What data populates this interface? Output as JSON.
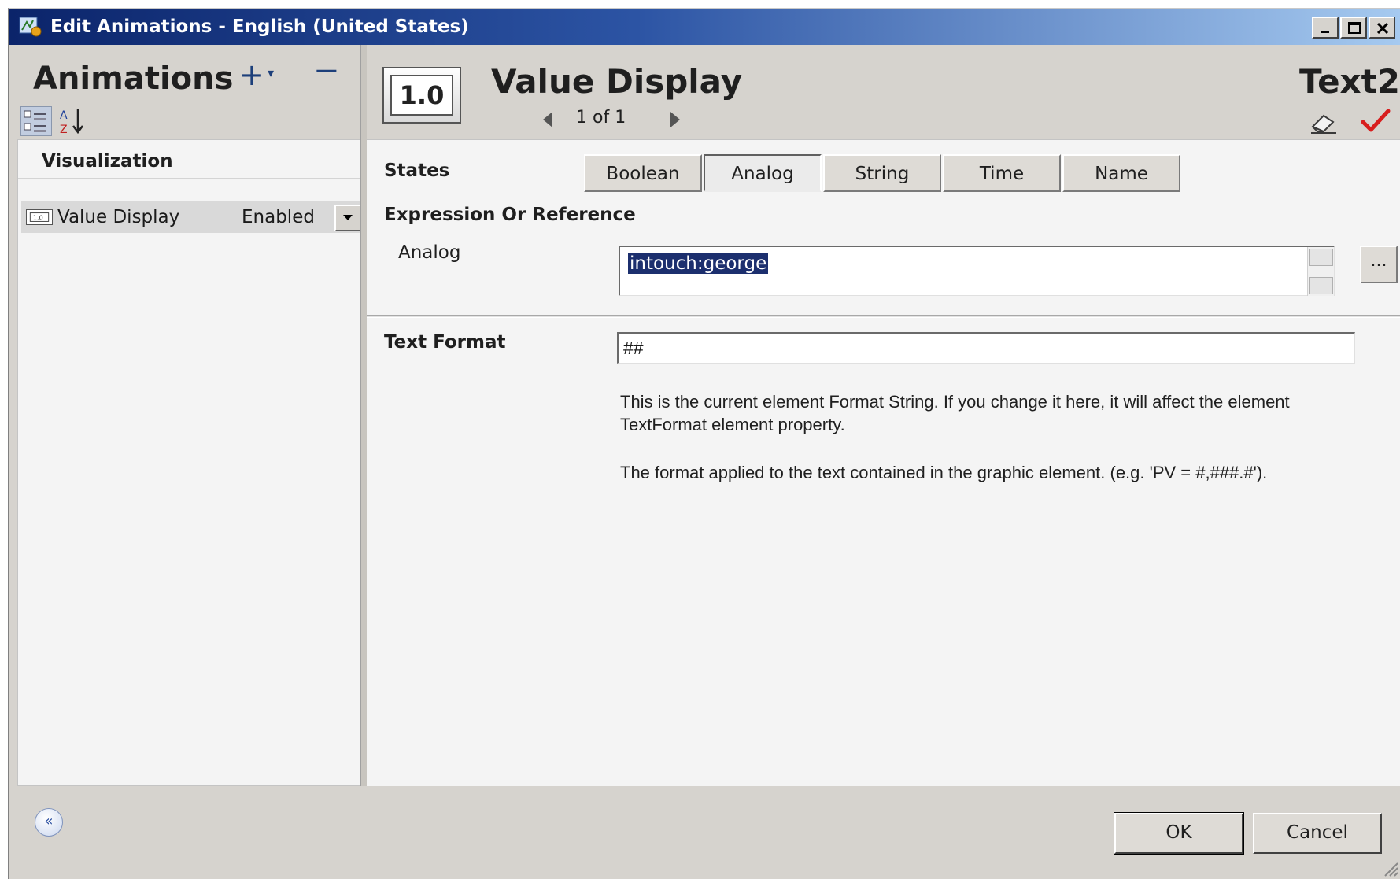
{
  "window": {
    "title": "Edit Animations - English (United States)"
  },
  "left_panel": {
    "title": "Animations",
    "add_label": "+",
    "remove_label": "−",
    "section": "Visualization",
    "animations": [
      {
        "name": "Value Display",
        "status": "Enabled"
      }
    ]
  },
  "header": {
    "badge": "1.0",
    "animation_name": "Value Display",
    "pager": "1 of 1",
    "element_name": "Text2"
  },
  "states": {
    "label": "States",
    "tabs": [
      "Boolean",
      "Analog",
      "String",
      "Time",
      "Name"
    ],
    "active": "Analog"
  },
  "expression": {
    "label": "Expression Or Reference",
    "field_label": "Analog",
    "value": "intouch:george",
    "browse_label": "..."
  },
  "text_format": {
    "label": "Text Format",
    "value": "##",
    "help_1": "This is the current element Format String.  If you change it here, it will affect the element TextFormat element property.",
    "help_2": "The format applied to the text contained in the graphic element. (e.g. 'PV = #,###.#')."
  },
  "footer": {
    "collapse_label": "«",
    "ok_label": "OK",
    "cancel_label": "Cancel"
  },
  "colors": {
    "title_bar": "#0b246a",
    "selection": "#1c2f6e",
    "checkmark": "#d81e1e"
  }
}
